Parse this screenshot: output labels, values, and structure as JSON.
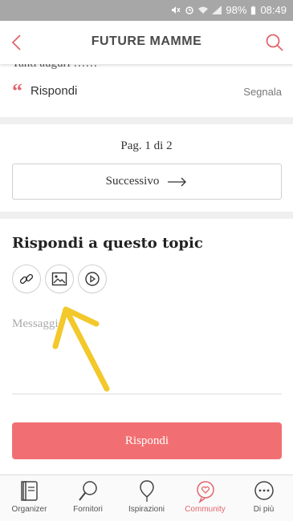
{
  "status_bar": {
    "battery": "98%",
    "time": "08:49"
  },
  "header": {
    "title": "FUTURE MAMME"
  },
  "post": {
    "cut_text": "Tanti auguri !!!!!!",
    "reply_label": "Rispondi",
    "report_label": "Segnala"
  },
  "pagination": {
    "text": "Pag. 1 di 2",
    "next_label": "Successivo"
  },
  "reply_form": {
    "title": "Rispondi a questo topic",
    "tools": [
      "link-icon",
      "image-icon",
      "video-icon"
    ],
    "message_placeholder": "Messaggio",
    "submit_label": "Rispondi"
  },
  "annotation": {
    "color": "#f2c82b"
  },
  "colors": {
    "accent": "#f16f72",
    "accent_dark": "#e1666c"
  },
  "bottom_nav": [
    {
      "label": "Organizer",
      "icon": "organizer-icon",
      "active": false
    },
    {
      "label": "Fornitori",
      "icon": "fornitori-icon",
      "active": false
    },
    {
      "label": "Ispirazioni",
      "icon": "ispirazioni-icon",
      "active": false
    },
    {
      "label": "Community",
      "icon": "community-icon",
      "active": true
    },
    {
      "label": "Di più",
      "icon": "more-icon",
      "active": false
    }
  ]
}
